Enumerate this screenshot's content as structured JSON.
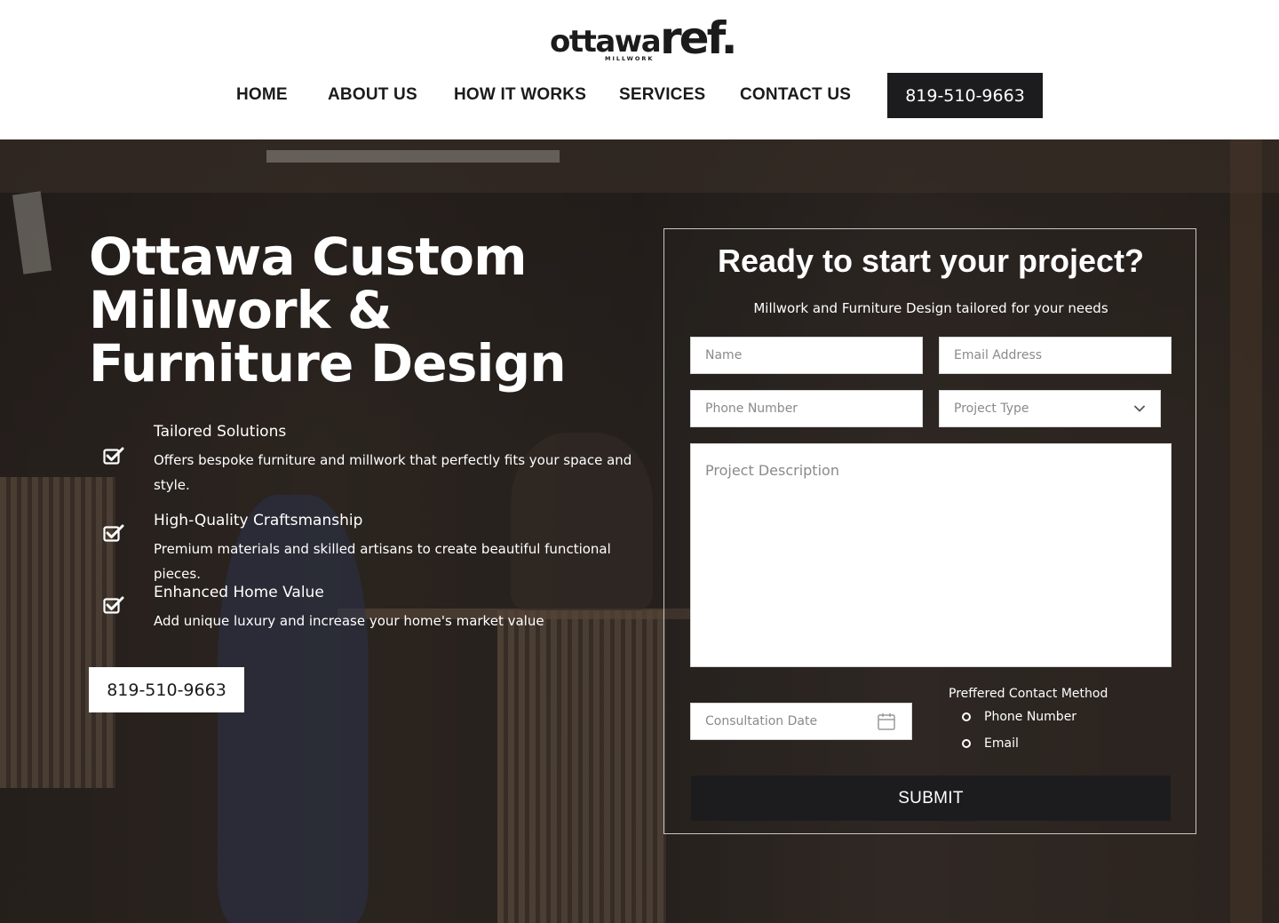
{
  "brand": {
    "logo_word1": "ottawa",
    "logo_word2": "ref.",
    "logo_sub": "MILLWORK"
  },
  "nav": {
    "items": [
      {
        "label": "HOME"
      },
      {
        "label": "ABOUT US"
      },
      {
        "label": "HOW IT WORKS"
      },
      {
        "label": "SERVICES"
      },
      {
        "label": "CONTACT US"
      }
    ],
    "phone": "819-510-9663"
  },
  "hero": {
    "title_lines": [
      "Ottawa Custom",
      "Millwork &",
      "Furniture Design"
    ],
    "features": [
      {
        "title": "Tailored Solutions",
        "description": "Offers bespoke furniture and millwork that perfectly fits your space and style.",
        "icon": "checkbox-check-icon"
      },
      {
        "title": "High-Quality Craftsmanship",
        "description": "Premium materials and skilled artisans to create beautiful functional pieces.",
        "icon": "checkbox-check-icon"
      },
      {
        "title": "Enhanced Home Value",
        "description": "Add unique luxury and increase your home's market value",
        "icon": "checkbox-check-icon"
      }
    ],
    "phone": "819-510-9663"
  },
  "form": {
    "title": "Ready to start your project?",
    "subtitle": "Millwork and Furniture Design  tailored for your needs",
    "name_placeholder": "Name",
    "email_placeholder": "Email Address",
    "phone_placeholder": "Phone Number",
    "project_type_placeholder": "Project Type",
    "description_placeholder": "Project Description",
    "date_placeholder": "Consultation Date",
    "contact_method_label": "Preffered Contact Method",
    "contact_options": [
      "Phone Number",
      "Email"
    ],
    "submit_label": "SUBMIT"
  },
  "colors": {
    "dark": "#1c1c1f",
    "white": "#ffffff"
  }
}
